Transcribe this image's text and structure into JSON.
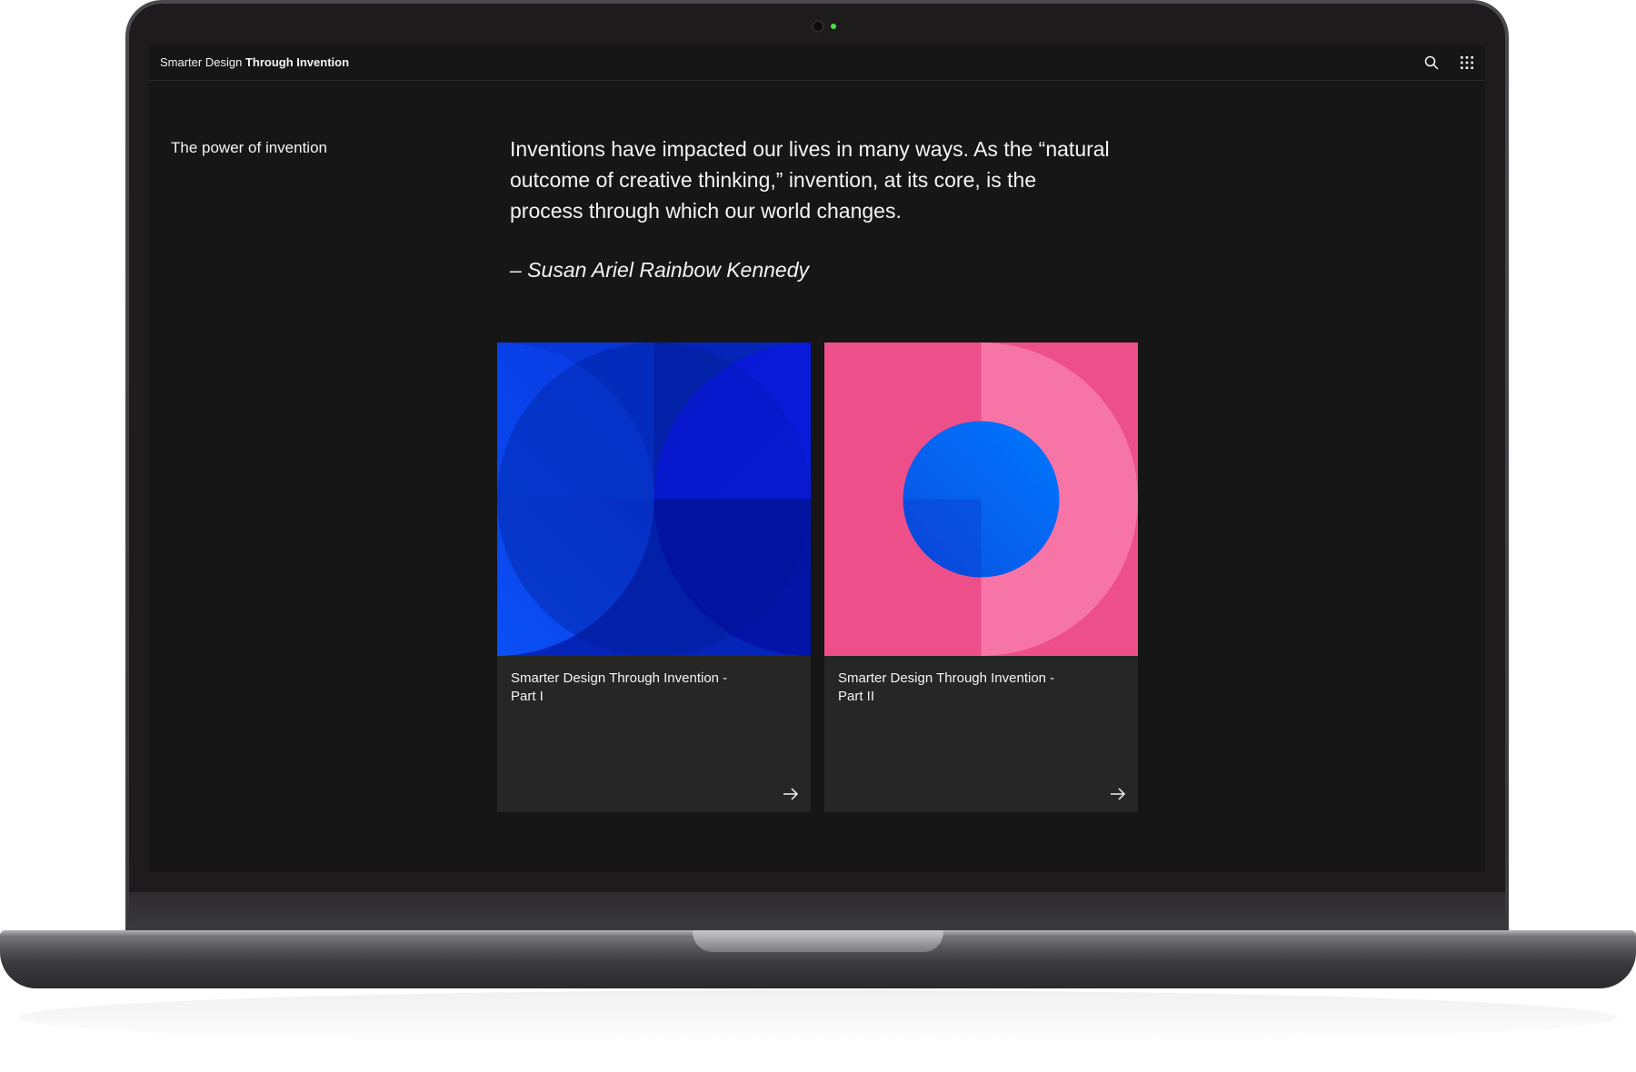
{
  "app": {
    "title_regular": "Smarter Design",
    "title_bold": "Through Invention"
  },
  "header": {
    "icons": [
      "search-icon",
      "app-switcher-icon"
    ]
  },
  "sidebar": {
    "label": "The power of invention"
  },
  "main": {
    "quote": "Inventions have impacted our lives in many ways. As the “natural outcome of creative thinking,” invention, at its core, is the process through which our world changes.",
    "author": "– Susan Ariel Rainbow Kennedy"
  },
  "cards": [
    {
      "title": "Smarter Design Through Invention - Part I",
      "icon": "arrow-right-icon",
      "art": "blue-circles-artwork"
    },
    {
      "title": "Smarter Design Through Invention - Part II",
      "icon": "arrow-right-icon",
      "art": "pink-blue-circle-artwork"
    }
  ],
  "colors": {
    "screen_bg": "#161616",
    "card_bg": "#262626",
    "text": "#f4f4f4",
    "blue_primary": "#0f3bff",
    "blue_dark": "#001a8c",
    "pink": "#ec4f8a",
    "pink_light": "#f775a6",
    "blue_circle": "#0062f5",
    "camera_led": "#4be04b"
  }
}
